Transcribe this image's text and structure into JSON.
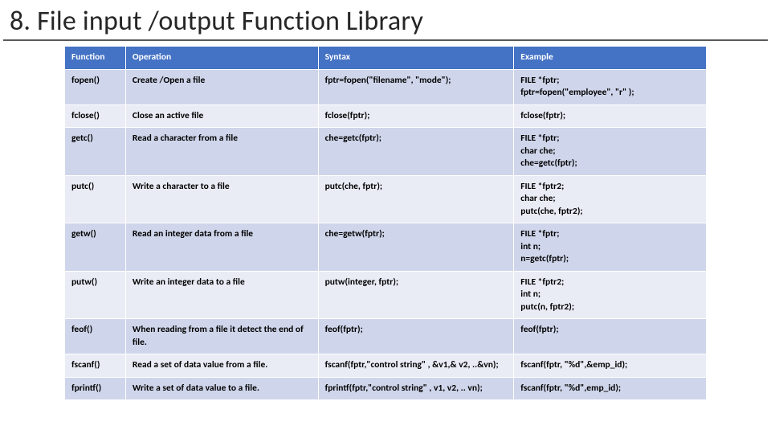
{
  "title": "8. File input /output Function Library",
  "headers": {
    "c1": "Function",
    "c2": "Operation",
    "c3": "Syntax",
    "c4": "Example"
  },
  "rows": [
    {
      "func": "fopen()",
      "op": "Create /Open a file",
      "syntax": "fptr=fopen(\"filename\", \"mode\");",
      "example": "FILE *fptr;\nfptr=fopen(\"employee\", \"r\" );"
    },
    {
      "func": "fclose()",
      "op": "Close an active file",
      "syntax": "fclose(fptr);",
      "example": "fclose(fptr);"
    },
    {
      "func": "getc()",
      "op": "Read a character from a file",
      "syntax": "che=getc(fptr);",
      "example": "FILE *fptr;\nchar che;\nche=getc(fptr);"
    },
    {
      "func": "putc()",
      "op": "Write a character to a file",
      "syntax": "putc(che, fptr);",
      "example": "FILE *fptr2;\nchar che;\nputc(che, fptr2);"
    },
    {
      "func": "getw()",
      "op": "Read an integer data from a file",
      "syntax": "che=getw(fptr);",
      "example": "FILE *fptr;\nint n;\nn=getc(fptr);"
    },
    {
      "func": "putw()",
      "op": "Write an integer data to a file",
      "syntax": "putw(integer, fptr);",
      "example": "FILE *fptr2;\nint n;\nputc(n, fptr2);"
    },
    {
      "func": "feof()",
      "op": "When reading from a file it detect the end of file.",
      "syntax": "feof(fptr);",
      "example": "feof(fptr);"
    },
    {
      "func": "fscanf()",
      "op": "Read a set of data value from a file.",
      "syntax": "fscanf(fptr,\"control string\" , &v1,& v2, ..&vn);",
      "example": "fscanf(fptr, \"%d\",&emp_id);"
    },
    {
      "func": "fprintf()",
      "op": "Write a set of data value to a file.",
      "syntax": "fprintf(fptr,\"control string\" , v1, v2, .. vn);",
      "example": "fscanf(fptr, \"%d\",emp_id);"
    }
  ]
}
